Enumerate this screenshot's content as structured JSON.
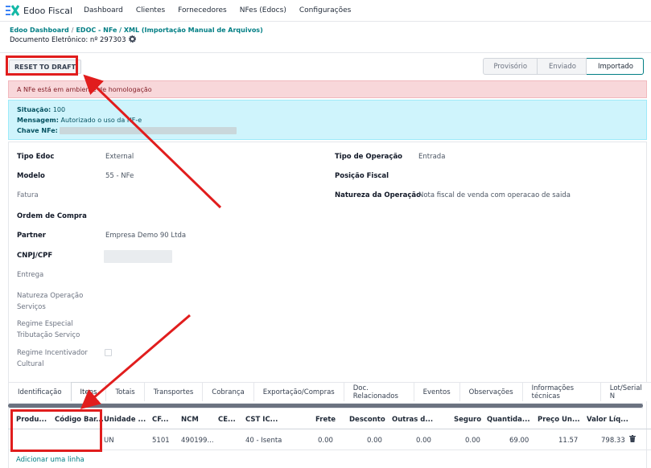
{
  "app": {
    "brand": "Edoo Fiscal",
    "nav": [
      "Dashboard",
      "Clientes",
      "Fornecedores",
      "NFes (Edocs)",
      "Configurações"
    ]
  },
  "breadcrumb": {
    "items": [
      "Edoo Dashboard",
      "EDOC - NFe / XML (Importação Manual de Arquivos)"
    ],
    "separator": "/",
    "document": "Documento Eletrônico: nº 297303"
  },
  "toolbar": {
    "reset_label": "RESET TO DRAFT",
    "stages": [
      "Provisório",
      "Enviado",
      "Importado"
    ],
    "active_stage": "Importado"
  },
  "alerts": {
    "danger": "A NFe está em ambiente de homologação",
    "info": {
      "situacao_label": "Situação:",
      "situacao_value": "100",
      "mensagem_label": "Mensagem:",
      "mensagem_value": "Autorizado o uso da NF-e",
      "chave_label": "Chave NFe:"
    }
  },
  "form": {
    "left": [
      {
        "label": "Tipo Edoc",
        "value": "External",
        "bold": true
      },
      {
        "label": "Modelo",
        "value": "55 - NFe",
        "bold": true
      },
      {
        "label": "Fatura",
        "value": "",
        "bold": false
      },
      {
        "label": "Ordem de Compra",
        "value": "",
        "bold": true
      },
      {
        "label": "Partner",
        "value": "Empresa Demo 90 Ltda",
        "bold": true
      },
      {
        "label": "CNPJ/CPF",
        "value": "",
        "bold": true
      },
      {
        "label": "Entrega",
        "value": "",
        "bold": false
      },
      {
        "label": "Natureza Operação Serviços",
        "value": "",
        "bold": false
      },
      {
        "label": "Regime Especial Tributação Serviço",
        "value": "",
        "bold": false
      },
      {
        "label": "Regime Incentivador Cultural",
        "value": "",
        "bold": false
      }
    ],
    "right": [
      {
        "label": "Tipo de Operação",
        "value": "Entrada"
      },
      {
        "label": "Posição Fiscal",
        "value": ""
      },
      {
        "label": "Natureza da Operação",
        "value": "Nota fiscal de venda com operacao de saida"
      }
    ]
  },
  "tabs": [
    "Identificação",
    "Itens",
    "Totais",
    "Transportes",
    "Cobrança",
    "Exportação/Compras",
    "Doc. Relacionados",
    "Eventos",
    "Observações",
    "Informações técnicas",
    "Lot/Serial N"
  ],
  "active_tab": "Itens",
  "table": {
    "columns": [
      "Produ...",
      "Código Bar...",
      "Unidade ...",
      "CF...",
      "NCM",
      "CE...",
      "CST IC...",
      "Frete",
      "Desconto",
      "Outras d...",
      "Seguro",
      "Quantida...",
      "Preço Un...",
      "Valor Líq..."
    ],
    "rows": [
      [
        "",
        "",
        "UN",
        "5101",
        "490199...",
        "",
        "40 - Isenta",
        "0.00",
        "0.00",
        "0.00",
        "0.00",
        "69.00",
        "11.57",
        "798.33"
      ]
    ],
    "add_line": "Adicionar uma linha"
  },
  "colors": {
    "accent": "#017e84",
    "highlight": "#e11d1d",
    "danger_bg": "#f8d7da",
    "info_bg": "#cff4fc"
  }
}
